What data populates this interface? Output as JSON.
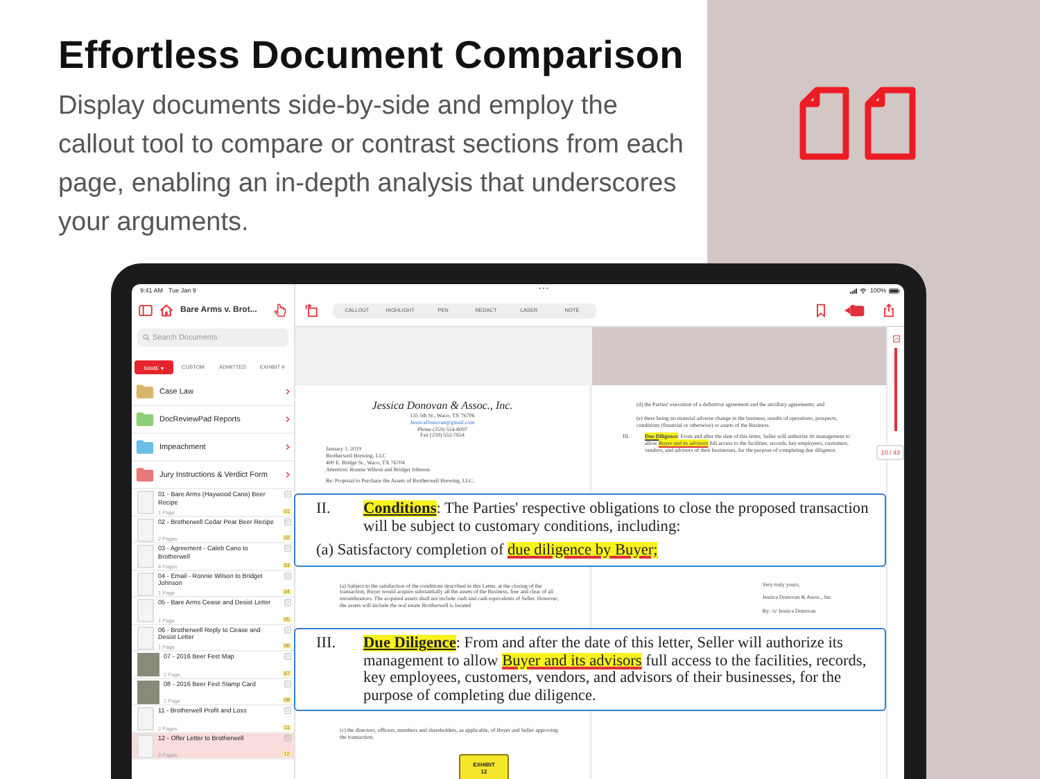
{
  "hero": {
    "title": "Effortless Document Comparison",
    "description": "Display documents side-by-side and employ the callout tool to compare or contrast sections from each page, enabling an in-depth analysis that underscores your arguments."
  },
  "status_bar": {
    "time": "9:41 AM",
    "date": "Tue Jan 9",
    "battery": "100%"
  },
  "sidebar": {
    "title": "Bare Arms v. Brot...",
    "search": {
      "placeholder": "Search Documents"
    },
    "sort_tabs": [
      {
        "label": "NAME ▾",
        "selected": true
      },
      {
        "label": "CUSTOM",
        "selected": false
      },
      {
        "label": "ADMITTED",
        "selected": false
      },
      {
        "label": "EXHIBIT #",
        "selected": false
      }
    ],
    "folders": [
      {
        "name": "Case Law",
        "color": "#d9b46c"
      },
      {
        "name": "DocReviewPad Reports",
        "color": "#8ccf78"
      },
      {
        "name": "Impeachment",
        "color": "#6cbfe6"
      },
      {
        "name": "Jury Instructions & Verdict Form",
        "color": "#e57878"
      }
    ],
    "documents": [
      {
        "title": "01 - Bare Arms (Haywood Cano) Beer Recipe",
        "pages": "1 Page",
        "exhibit": "01",
        "kind": "page",
        "selected": false
      },
      {
        "title": "02 - Brotherwell Cedar Pear Beer Recipe",
        "pages": "2 Pages",
        "exhibit": "02",
        "kind": "page",
        "selected": false
      },
      {
        "title": "03 - Agreement - Caleb Cano to Brotherwell",
        "pages": "4 Pages",
        "exhibit": "03",
        "kind": "page",
        "selected": false
      },
      {
        "title": "04 - Email - Ronnie Wilson to Bridget Johnson",
        "pages": "1 Page",
        "exhibit": "04",
        "kind": "page",
        "selected": false
      },
      {
        "title": "05 - Bare Arms Cease and Desist Letter",
        "pages": "1 Page",
        "exhibit": "05",
        "kind": "page",
        "selected": false
      },
      {
        "title": "06 - Brotherwell Reply to Cease and Desist Letter",
        "pages": "1 Page",
        "exhibit": "06",
        "kind": "page",
        "selected": false
      },
      {
        "title": "07 - 2016 Beer Fest Map",
        "pages": "1 Page",
        "exhibit": "07",
        "kind": "photo",
        "selected": false
      },
      {
        "title": "08 - 2016 Beer Fest Stamp Card",
        "pages": "1 Page",
        "exhibit": "08",
        "kind": "photo",
        "selected": false
      },
      {
        "title": "11 - Brotherwell Profit and Loss",
        "pages": "2 Pages",
        "exhibit": "11",
        "kind": "page",
        "selected": false
      },
      {
        "title": "12 - Offer Letter to Brotherwell",
        "pages": "2 Pages",
        "exhibit": "12",
        "kind": "page",
        "selected": true
      }
    ]
  },
  "toolbar": {
    "tools": [
      "CALLOUT",
      "HIGHLIGHT",
      "PEN",
      "REDACT",
      "LASER",
      "NOTE"
    ]
  },
  "viewer": {
    "page_indicator": "10 / 43",
    "sections": [
      {
        "kind": "pages",
        "left": [
          {
            "kind": "firm",
            "text": "Jessica Donovan & Assoc., Inc."
          },
          {
            "kind": "center",
            "text": "135 5th St., Waco, TX 76706"
          },
          {
            "kind": "email",
            "text": "JessicaDonovan@gmail.com"
          },
          {
            "kind": "center",
            "text": "Phone (259) 554-8097"
          },
          {
            "kind": "center",
            "text": "Fax (259) 552-7654"
          },
          {
            "kind": "line",
            "text": "January 1, 2019"
          },
          {
            "kind": "line",
            "text": "Brotherwell Brewing, LLC"
          },
          {
            "kind": "line",
            "text": "400 E. Bridge St., Waco, TX 76704"
          },
          {
            "kind": "line",
            "text": "Attention: Ronnie Wilson and Bridget Johnson"
          },
          {
            "kind": "para",
            "text": "Re: Proposal to Purchase the Assets of Brotherwell Brewing, LLC."
          }
        ],
        "right": [
          {
            "kind": "para",
            "text": "(d) the Parties' execution of a definitive agreement and the ancillary agreements; and"
          },
          {
            "kind": "para",
            "text": "(e) there being no material adverse change in the business, results of operations, prospects, conditions (financial or otherwise) or assets of the Business."
          },
          {
            "kind": "numbered",
            "number": "III.",
            "segments": [
              {
                "kind": "heading",
                "text": "Due Diligence"
              },
              {
                "kind": "text",
                "text": ": From and after the date of this letter, Seller will authorize its management to allow "
              },
              {
                "kind": "highlight",
                "text": "Buyer and its advisors"
              },
              {
                "kind": "text",
                "text": " full access to the facilities, records, key employees, customers, vendors, and advisors of their businesses, for the purpose of completing due diligence."
              }
            ]
          }
        ]
      },
      {
        "kind": "callout",
        "number": "II.",
        "paragraphs": [
          [
            {
              "kind": "heading",
              "text": "Conditions"
            },
            {
              "kind": "text",
              "text": ": The Parties' respective obligations to close the proposed transaction will be subject to customary conditions, including:"
            }
          ],
          [
            {
              "kind": "text",
              "text": "(a) Satisfactory completion of "
            },
            {
              "kind": "highlight",
              "text": "due diligence by Buyer;"
            }
          ]
        ]
      },
      {
        "kind": "pages",
        "left": [
          {
            "kind": "para",
            "text": "(a) Subject to the satisfaction of the conditions described in this Letter, at the closing of the transaction, Buyer would acquire substantially all the assets of the Business, free and clear of all encumbrances. The acquired assets shall not include cash and cash equivalents of Seller. However, the assets will include the real estate Brotherwell is located"
          }
        ],
        "right": [
          {
            "kind": "sign",
            "text": "Very truly yours,"
          },
          {
            "kind": "sign",
            "text": "Jessica Donovan & Assoc., Inc."
          },
          {
            "kind": "sign",
            "text": "By: /s/ Jessica Donovan"
          }
        ]
      },
      {
        "kind": "callout",
        "number": "III.",
        "paragraphs": [
          [
            {
              "kind": "heading",
              "text": "Due Diligence"
            },
            {
              "kind": "text",
              "text": ": From and after the date of this letter, Seller will authorize its management to allow "
            },
            {
              "kind": "highlight",
              "text": "Buyer and its advisors"
            },
            {
              "kind": "text",
              "text": " full access to the facilities, records, key employees, customers, vendors, and advisors of their businesses, for the purpose of completing due diligence."
            }
          ]
        ]
      },
      {
        "kind": "pages",
        "left": [
          {
            "kind": "para",
            "text": "(c) the directors, officers, members and shareholders, as applicable, of Buyer and Seller approving the transaction;"
          },
          {
            "kind": "exhibit",
            "label": "EXHIBIT",
            "number": "12"
          }
        ]
      }
    ]
  }
}
